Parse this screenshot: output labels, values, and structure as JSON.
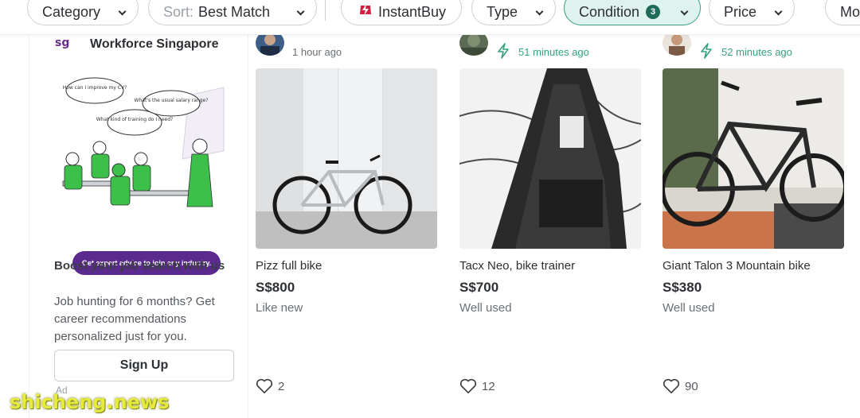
{
  "filters": {
    "category": "Category",
    "sort_prefix": "Sort:",
    "sort_value": "Best Match",
    "instantbuy": "InstantBuy",
    "type": "Type",
    "condition": "Condition",
    "condition_count": "3",
    "price": "Price",
    "more": "Mo"
  },
  "ad": {
    "brand_logo": "sg",
    "brand": "Workforce Singapore",
    "bubbles": [
      "How can I improve my CV?",
      "What kind of training do I need?",
      "What's the usual salary range?"
    ],
    "cta": "Get expert advice to join any industry.",
    "headline": "Boost your job search with us",
    "body": "Job hunting for 6 months? Get career recommendations personalized just for you.",
    "button": "Sign Up",
    "label": "Ad"
  },
  "listings": [
    {
      "time": "1 hour ago",
      "title": "Pizz full bike",
      "price": "S$800",
      "condition": "Like new",
      "likes": "2"
    },
    {
      "time": "51 minutes ago",
      "title": "Tacx Neo, bike trainer",
      "price": "S$700",
      "condition": "Well used",
      "likes": "12"
    },
    {
      "time": "52 minutes ago",
      "title": "Giant Talon 3 Mountain bike",
      "price": "S$380",
      "condition": "Well used",
      "likes": "90"
    }
  ],
  "colors": {
    "accent_green": "#34a27e",
    "active_chip_bg": "#dff3ee",
    "ad_purple": "#5a2a8e"
  },
  "watermark": "shicheng.news"
}
